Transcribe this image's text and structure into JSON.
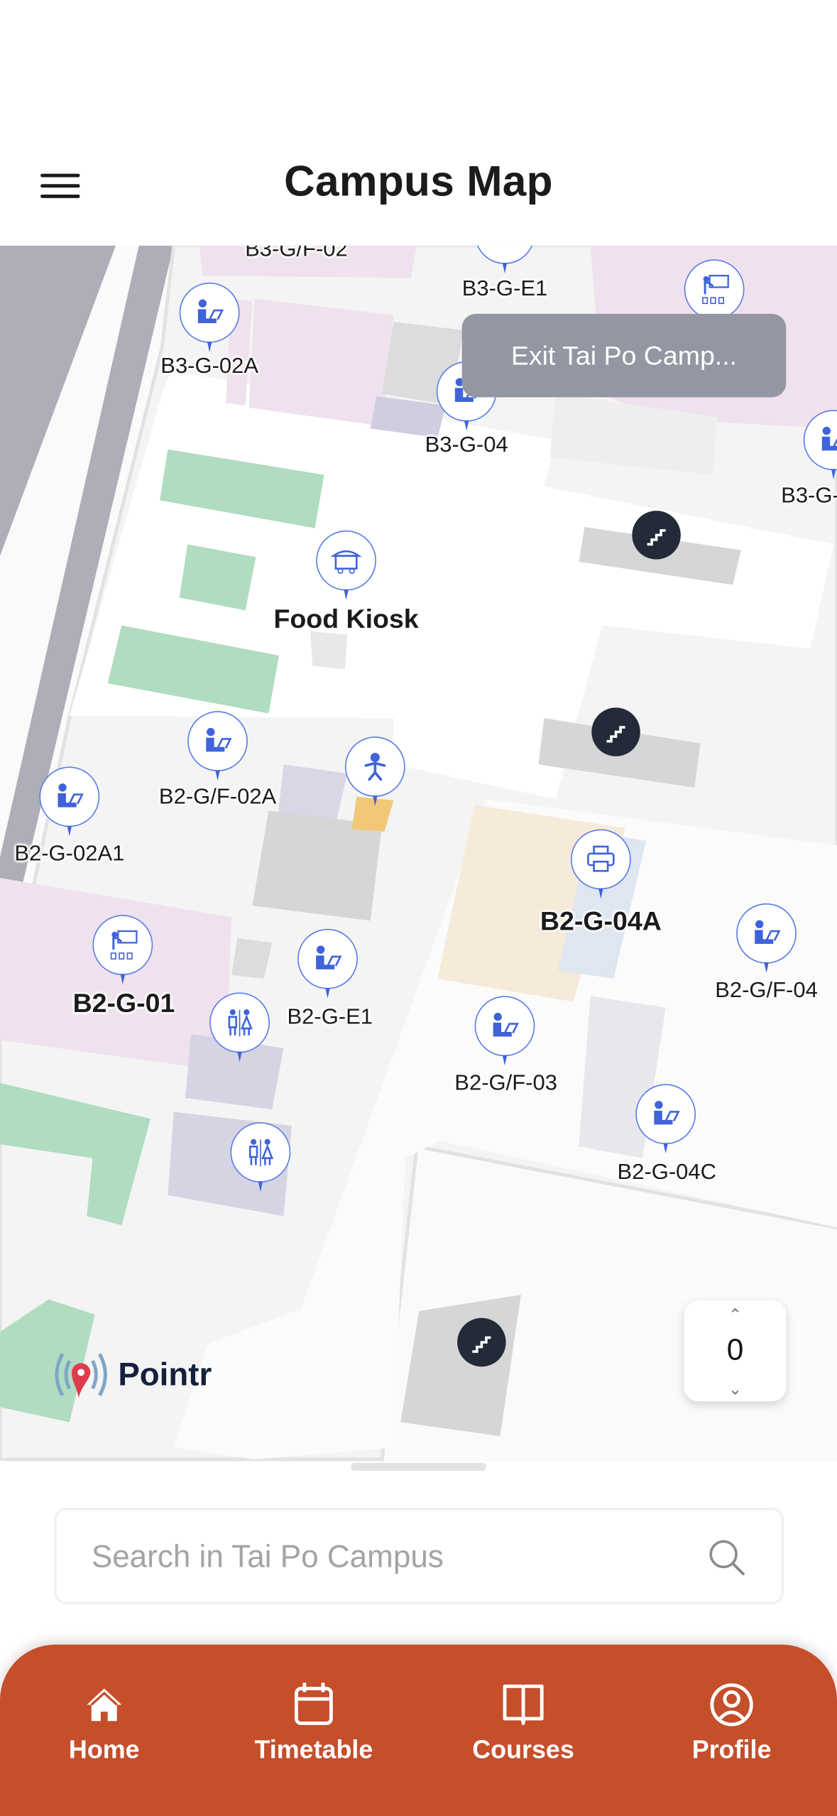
{
  "header": {
    "title": "Campus Map",
    "menu_icon": "hamburger-icon"
  },
  "map": {
    "exit_button": "Exit Tai Po Camp...",
    "floor_selector": {
      "value": "0",
      "up_icon": "chevron-up-icon",
      "down_icon": "chevron-down-icon"
    },
    "attribution": "Pointr",
    "poi_labels": [
      "B3-G/F-02",
      "B3-G-E1",
      "B3-G-02A",
      "B3-G-04",
      "B3-G-",
      "Food Kiosk",
      "B2-G/F-02A",
      "B2-G-02A1",
      "B2-G-04A",
      "B2-G/F-04",
      "B2-G-01",
      "B2-G-E1",
      "B2-G/F-03",
      "B2-G-04C"
    ],
    "colors": {
      "pin_blue": "#3f63d9",
      "room_pink": "#efe1ee",
      "green_area": "#b0dcc0",
      "road": "#aeaeb8",
      "stairs": "#232b38"
    }
  },
  "search": {
    "placeholder": "Search in Tai Po Campus"
  },
  "nav": {
    "accent": "#c54e2b",
    "items": [
      {
        "label": "Home",
        "icon": "home-icon"
      },
      {
        "label": "Timetable",
        "icon": "calendar-icon"
      },
      {
        "label": "Courses",
        "icon": "book-icon"
      },
      {
        "label": "Profile",
        "icon": "user-circle-icon"
      }
    ]
  }
}
